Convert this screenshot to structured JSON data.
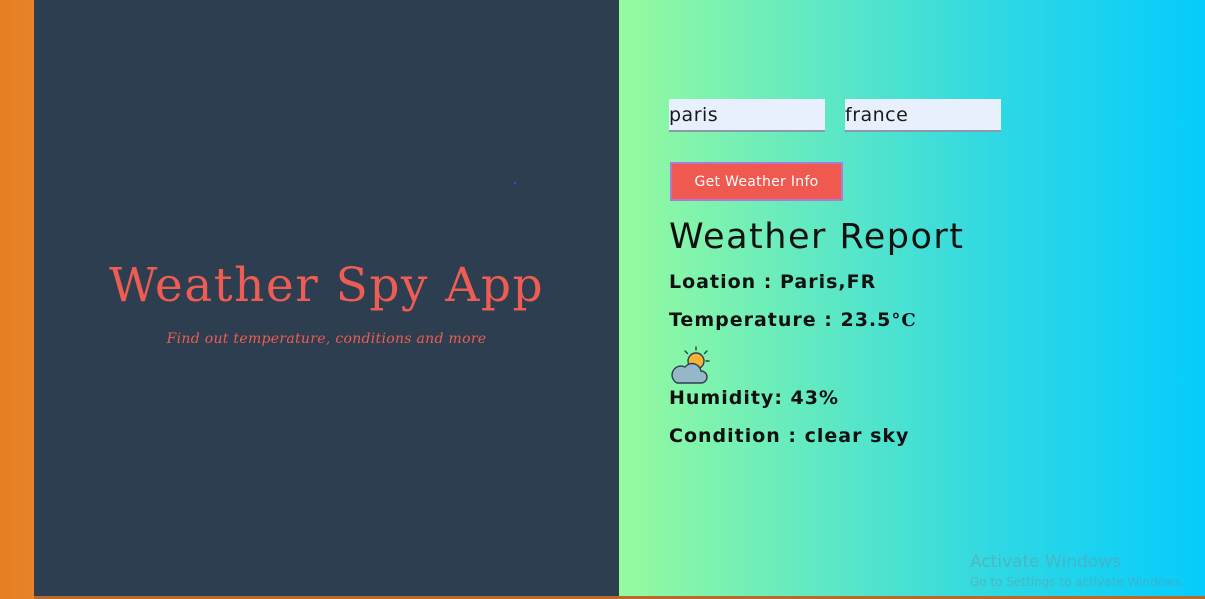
{
  "left": {
    "title": "Weather Spy App",
    "subtitle": "Find out temperature, conditions and more"
  },
  "form": {
    "city_value": "paris",
    "country_value": "france",
    "button_label": "Get Weather Info"
  },
  "report": {
    "title": "Weather Report",
    "location_text": "Loation : Paris,FR",
    "temperature_text": "Temperature : 23.5",
    "temperature_unit": "°C",
    "icon": "partly-cloudy-day-icon",
    "humidity_text": "Humidity: 43%",
    "condition_text": "Condition : clear sky"
  },
  "watermark": {
    "title": "Activate Windows",
    "subtitle": "Go to Settings to activate Windows."
  },
  "colors": {
    "left_panel": "#2c3e50",
    "accent": "#ee5c53",
    "button": "#f0594f",
    "gradient_start": "#96fb9e",
    "gradient_end": "#05ccfd",
    "frame": "#e67e22"
  }
}
